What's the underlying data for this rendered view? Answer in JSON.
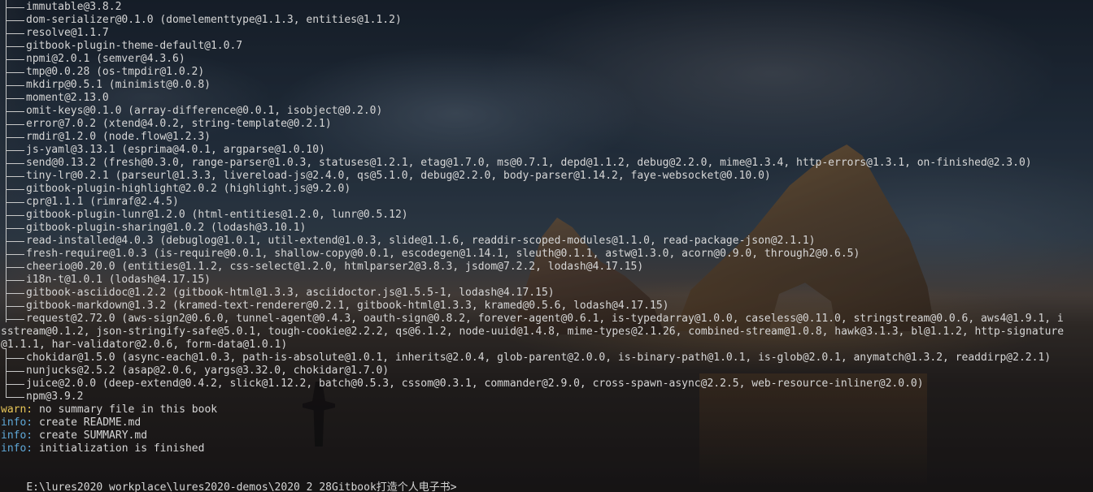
{
  "tree_lines": [
    {
      "text": "immutable@3.8.2",
      "cont": false
    },
    {
      "text": "dom-serializer@0.1.0 (domelementtype@1.1.3, entities@1.1.2)",
      "cont": false
    },
    {
      "text": "resolve@1.1.7",
      "cont": false
    },
    {
      "text": "gitbook-plugin-theme-default@1.0.7",
      "cont": false
    },
    {
      "text": "npmi@2.0.1 (semver@4.3.6)",
      "cont": false
    },
    {
      "text": "tmp@0.0.28 (os-tmpdir@1.0.2)",
      "cont": false
    },
    {
      "text": "mkdirp@0.5.1 (minimist@0.0.8)",
      "cont": false
    },
    {
      "text": "moment@2.13.0",
      "cont": false
    },
    {
      "text": "omit-keys@0.1.0 (array-difference@0.0.1, isobject@0.2.0)",
      "cont": false
    },
    {
      "text": "error@7.0.2 (xtend@4.0.2, string-template@0.2.1)",
      "cont": false
    },
    {
      "text": "rmdir@1.2.0 (node.flow@1.2.3)",
      "cont": false
    },
    {
      "text": "js-yaml@3.13.1 (esprima@4.0.1, argparse@1.0.10)",
      "cont": false
    },
    {
      "text": "send@0.13.2 (fresh@0.3.0, range-parser@1.0.3, statuses@1.2.1, etag@1.7.0, ms@0.7.1, depd@1.1.2, debug@2.2.0, mime@1.3.4, http-errors@1.3.1, on-finished@2.3.0)",
      "cont": false
    },
    {
      "text": "tiny-lr@0.2.1 (parseurl@1.3.3, livereload-js@2.4.0, qs@5.1.0, debug@2.2.0, body-parser@1.14.2, faye-websocket@0.10.0)",
      "cont": false
    },
    {
      "text": "gitbook-plugin-highlight@2.0.2 (highlight.js@9.2.0)",
      "cont": false
    },
    {
      "text": "cpr@1.1.1 (rimraf@2.4.5)",
      "cont": false
    },
    {
      "text": "gitbook-plugin-lunr@1.2.0 (html-entities@1.2.0, lunr@0.5.12)",
      "cont": false
    },
    {
      "text": "gitbook-plugin-sharing@1.0.2 (lodash@3.10.1)",
      "cont": false
    },
    {
      "text": "read-installed@4.0.3 (debuglog@1.0.1, util-extend@1.0.3, slide@1.1.6, readdir-scoped-modules@1.1.0, read-package-json@2.1.1)",
      "cont": false
    },
    {
      "text": "fresh-require@1.0.3 (is-require@0.0.1, shallow-copy@0.0.1, escodegen@1.14.1, sleuth@0.1.1, astw@1.3.0, acorn@0.9.0, through2@0.6.5)",
      "cont": false
    },
    {
      "text": "cheerio@0.20.0 (entities@1.1.2, css-select@1.2.0, htmlparser2@3.8.3, jsdom@7.2.2, lodash@4.17.15)",
      "cont": false
    },
    {
      "text": "i18n-t@1.0.1 (lodash@4.17.15)",
      "cont": false
    },
    {
      "text": "gitbook-asciidoc@1.2.2 (gitbook-html@1.3.3, asciidoctor.js@1.5.5-1, lodash@4.17.15)",
      "cont": false
    },
    {
      "text": "gitbook-markdown@1.3.2 (kramed-text-renderer@0.2.1, gitbook-html@1.3.3, kramed@0.5.6, lodash@4.17.15)",
      "cont": false
    },
    {
      "text": "request@2.72.0 (aws-sign2@0.6.0, tunnel-agent@0.4.3, oauth-sign@0.8.2, forever-agent@0.6.1, is-typedarray@1.0.0, caseless@0.11.0, stringstream@0.0.6, aws4@1.9.1, i",
      "cont": false
    },
    {
      "text": "sstream@0.1.2, json-stringify-safe@5.0.1, tough-cookie@2.2.2, qs@6.1.2, node-uuid@1.4.8, mime-types@2.1.26, combined-stream@1.0.8, hawk@3.1.3, bl@1.1.2, http-signature",
      "cont": true
    },
    {
      "text": "@1.1.1, har-validator@2.0.6, form-data@1.0.1)",
      "cont": true
    },
    {
      "text": "chokidar@1.5.0 (async-each@1.0.3, path-is-absolute@1.0.1, inherits@2.0.4, glob-parent@2.0.0, is-binary-path@1.0.1, is-glob@2.0.1, anymatch@1.3.2, readdirp@2.2.1)",
      "cont": false
    },
    {
      "text": "nunjucks@2.5.2 (asap@2.0.6, yargs@3.32.0, chokidar@1.7.0)",
      "cont": false
    },
    {
      "text": "juice@2.0.0 (deep-extend@0.4.2, slick@1.12.2, batch@0.5.3, cssom@0.3.1, commander@2.9.0, cross-spawn-async@2.2.5, web-resource-inliner@2.0.0)",
      "cont": false
    },
    {
      "text": "npm@3.9.2",
      "cont": false,
      "last": true
    }
  ],
  "log_lines": [
    {
      "level": "warn:",
      "type": "warn",
      "text": " no summary file in this book"
    },
    {
      "level": "info:",
      "type": "info",
      "text": " create README.md"
    },
    {
      "level": "info:",
      "type": "info",
      "text": " create SUMMARY.md"
    },
    {
      "level": "info:",
      "type": "info",
      "text": " initialization is finished"
    }
  ],
  "prompt": "E:\\lures2020_workplace\\lures2020-demos\\2020_2_28Gitbook打造个人电子书>",
  "colors": {
    "text": "#d6d6d6",
    "warn": "#e8c658",
    "info": "#5fa8d8"
  }
}
